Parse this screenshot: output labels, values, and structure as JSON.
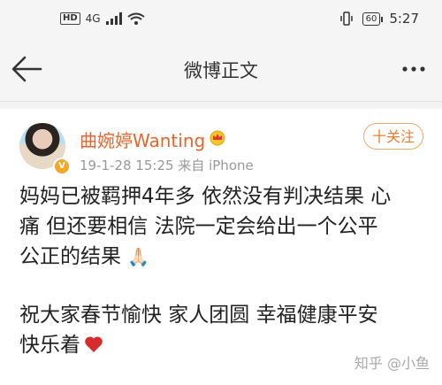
{
  "status_bar": {
    "hd": "HD",
    "signal": "4G",
    "battery": "60",
    "time": "5:27"
  },
  "nav": {
    "title": "微博正文"
  },
  "post": {
    "username": "曲婉婷Wanting",
    "date": "19-1-28 15:25",
    "source": "来自 iPhone",
    "follow_label": "十关注",
    "paragraph1_lines": [
      "妈妈已被羁押4年多 依然没有判决结果 心",
      "痛 但还要相信 法院一定会给出一个公平",
      "公正的结果"
    ],
    "paragraph2_lines": [
      "祝大家春节愉快 家人团圆 幸福健康平安",
      "快乐着"
    ],
    "emoji1": "🙏🏻",
    "emoji2": "heart"
  },
  "watermark": "知乎 @小鱼",
  "colors": {
    "username": "#e8652b",
    "follow_border": "#f3a766",
    "heart": "#d82b2b",
    "badge": "#f6a623"
  }
}
